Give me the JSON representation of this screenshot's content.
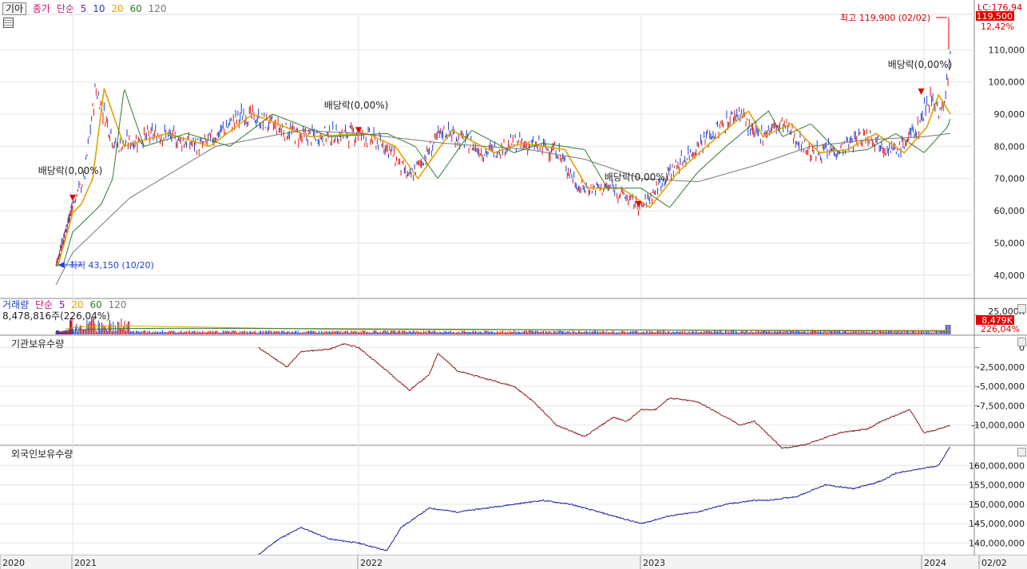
{
  "header": {
    "stock_name": "기아",
    "price_label": "종가",
    "ma_label": "단순",
    "ma_periods": [
      "5",
      "10",
      "20",
      "60",
      "120"
    ],
    "ma_colors": [
      "#7a1fa2",
      "#1f3fbf",
      "#e6a000",
      "#2e7d32",
      "#777777"
    ],
    "lc_label": "LC:176,94"
  },
  "price_badge": "119,500",
  "price_pct": "12,42%",
  "annotations": {
    "high": "최고 119,900 (02/02)",
    "low": "최저 43,150 (10/20)",
    "dividend": "배당락(0,00%)",
    "dividend_labels": [
      "배당락(0,00%)",
      "배당락(0,00%)",
      "배당락(0,00%)",
      "배당락(0,00%)"
    ]
  },
  "volume_header": {
    "title": "거래량",
    "ma_label": "단순",
    "ma_periods": [
      "5",
      "20",
      "60",
      "120"
    ],
    "value_text": "8,478,816주(226,04%)",
    "axis_top": "25,000K",
    "badge": "8,479K",
    "pct": "226,04%"
  },
  "inst_header": {
    "title": "기관보유수량"
  },
  "foreign_header": {
    "title": "외국인보유수량"
  },
  "chart_data": [
    {
      "type": "line",
      "title": "기아",
      "description": "Daily price (close) with moving averages",
      "y_ticks": [
        40000,
        50000,
        60000,
        70000,
        80000,
        90000,
        100000,
        110000
      ],
      "y_tick_labels": [
        "40,000",
        "50,000",
        "60,000",
        "70,000",
        "80,000",
        "90,000",
        "100,000",
        "110,000"
      ],
      "ylim": [
        33000,
        121000
      ],
      "x_labels": [
        "2020",
        "2021",
        "2022",
        "2023",
        "2024",
        "02/02"
      ],
      "series": [
        {
          "name": "종가",
          "x": [
            2020.77,
            2020.92,
            2021.0,
            2021.04,
            2021.08,
            2021.15,
            2021.3,
            2021.45,
            2021.6,
            2021.8,
            2022.0,
            2022.1,
            2022.18,
            2022.3,
            2022.45,
            2022.55,
            2022.7,
            2022.78,
            2022.9,
            2023.0,
            2023.1,
            2023.2,
            2023.35,
            2023.4,
            2023.5,
            2023.6,
            2023.7,
            2023.8,
            2023.9,
            2023.98,
            2024.02,
            2024.06,
            2024.09
          ],
          "values": [
            43150,
            55000,
            62000,
            70000,
            98000,
            80000,
            84000,
            80000,
            90000,
            83000,
            84000,
            80000,
            70000,
            85000,
            78000,
            81000,
            79000,
            67000,
            67000,
            61000,
            72000,
            80000,
            91000,
            83000,
            87000,
            78000,
            79000,
            84000,
            78000,
            86000,
            96000,
            90000,
            106000
          ]
        },
        {
          "name": "120",
          "x": [
            2020.77,
            2021.0,
            2021.2,
            2021.5,
            2021.8,
            2022.0,
            2022.3,
            2022.6,
            2022.8,
            2023.0,
            2023.2,
            2023.4,
            2023.6,
            2023.8,
            2024.0,
            2024.09
          ],
          "values": [
            37000,
            47000,
            64000,
            80000,
            85000,
            84000,
            81000,
            79000,
            76000,
            70000,
            69000,
            74000,
            80000,
            82000,
            83000,
            84000
          ]
        }
      ],
      "max_point": {
        "x": 2024.09,
        "value": 119900
      },
      "min_point": {
        "x": 2020.8,
        "value": 43150
      }
    },
    {
      "type": "bar",
      "title": "거래량",
      "values_note": "daily volume bars, latest 8,479K"
    },
    {
      "type": "line",
      "title": "기관보유수량",
      "y_ticks": [
        0,
        -2500000,
        -5000000,
        -7500000,
        -10000000
      ],
      "y_tick_labels": [
        "0",
        "-2,500,000",
        "-5,000,000",
        "-7,500,000",
        "-10,000,000"
      ],
      "ylim": [
        -12500000,
        1500000
      ],
      "x": [
        2021.65,
        2021.75,
        2021.8,
        2021.9,
        2021.95,
        2022.0,
        2022.1,
        2022.18,
        2022.25,
        2022.28,
        2022.35,
        2022.45,
        2022.55,
        2022.62,
        2022.7,
        2022.8,
        2022.9,
        2022.95,
        2023.0,
        2023.05,
        2023.1,
        2023.2,
        2023.35,
        2023.4,
        2023.5,
        2023.58,
        2023.62,
        2023.7,
        2023.8,
        2023.85,
        2023.95,
        2024.0,
        2024.05,
        2024.09
      ],
      "values": [
        0,
        -2500000,
        -500000,
        -200000,
        500000,
        0,
        -3000000,
        -5500000,
        -3500000,
        -700000,
        -3000000,
        -4000000,
        -5000000,
        -7000000,
        -10000000,
        -11500000,
        -9000000,
        -9500000,
        -8000000,
        -8000000,
        -6500000,
        -7000000,
        -10000000,
        -9500000,
        -13000000,
        -12500000,
        -12000000,
        -11000000,
        -10500000,
        -9500000,
        -8000000,
        -11000000,
        -10500000,
        -10000000
      ]
    },
    {
      "type": "line",
      "title": "외국인보유수량",
      "y_ticks": [
        140000000,
        145000000,
        150000000,
        155000000,
        160000000
      ],
      "y_tick_labels": [
        "140,000,000",
        "145,000,000",
        "150,000,000",
        "155,000,000",
        "160,000,000"
      ],
      "ylim": [
        137000000,
        165000000
      ],
      "x": [
        2021.65,
        2021.72,
        2021.8,
        2021.9,
        2022.0,
        2022.1,
        2022.15,
        2022.25,
        2022.35,
        2022.45,
        2022.55,
        2022.65,
        2022.75,
        2022.85,
        2022.95,
        2023.0,
        2023.1,
        2023.2,
        2023.3,
        2023.4,
        2023.45,
        2023.55,
        2023.65,
        2023.75,
        2023.85,
        2023.9,
        2023.98,
        2024.05,
        2024.09
      ],
      "values": [
        137000000,
        141000000,
        144000000,
        141000000,
        140000000,
        138000000,
        144000000,
        149000000,
        148000000,
        149000000,
        150000000,
        151000000,
        150000000,
        148000000,
        146000000,
        145000000,
        147000000,
        148000000,
        150000000,
        151000000,
        151000000,
        152000000,
        155000000,
        154000000,
        156000000,
        158000000,
        159000000,
        160000000,
        165000000
      ]
    }
  ]
}
